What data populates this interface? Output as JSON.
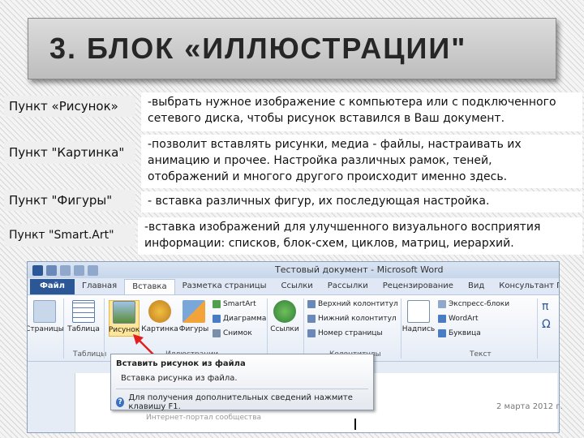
{
  "slide": {
    "title": "3. БЛОК «ИЛЛЮСТРАЦИИ\"",
    "rows": [
      {
        "label": "Пункт «Рисунок»",
        "description": "-выбрать нужное изображение с компьютера или с подключенного сетевого диска, чтобы рисунок вставился в Ваш документ."
      },
      {
        "label": "Пункт \"Картинка\"",
        "description": " -позволит вставлять рисунки, медиа - файлы, настраивать их анимацию и прочее. Настройка различных рамок, теней, отображений и многого другого происходит именно здесь."
      },
      {
        "label": "Пункт \"Фигуры\"",
        "description": "- вставка различных фигур, их последующая настройка."
      },
      {
        "label": "Пункт \"Smart.Art\"",
        "description": "-вставка изображений для улучшенного визуального восприятия информации: списков, блок-схем, циклов, матриц, иерархий."
      }
    ]
  },
  "word": {
    "window_title": "Тестовый документ - Microsoft Word",
    "tabs": [
      "Файл",
      "Главная",
      "Вставка",
      "Разметка страницы",
      "Ссылки",
      "Рассылки",
      "Рецензирование",
      "Вид",
      "Консультант Плюс"
    ],
    "active_tab": "Вставка",
    "ribbon": {
      "buttons": [
        "Страницы",
        "Таблица",
        "Рисунок",
        "Картинка",
        "Фигуры",
        "Ссылки",
        "Надпись"
      ],
      "small_items": [
        "SmartArt",
        "Диаграмма",
        "Снимок",
        "Верхний колонтитул",
        "Нижний колонтитул",
        "Номер страницы",
        "Экспресс-блоки",
        "WordArt",
        "Буквица"
      ],
      "groups": [
        "Таблицы",
        "Иллюстрации",
        "Колонтитулы",
        "Текст"
      ]
    },
    "tooltip": {
      "title": "Вставить рисунок из файла",
      "description": "Вставка рисунка из файла.",
      "help": "Для получения дополнительных сведений нажмите клавишу F1."
    },
    "status_date": "2 марта 2012 г.",
    "doc_fragment": "Интернет-портал сообщества"
  },
  "colors": {
    "file_tab": "#2b5797",
    "highlight": "#fde59a",
    "arrow": "#e02020"
  }
}
